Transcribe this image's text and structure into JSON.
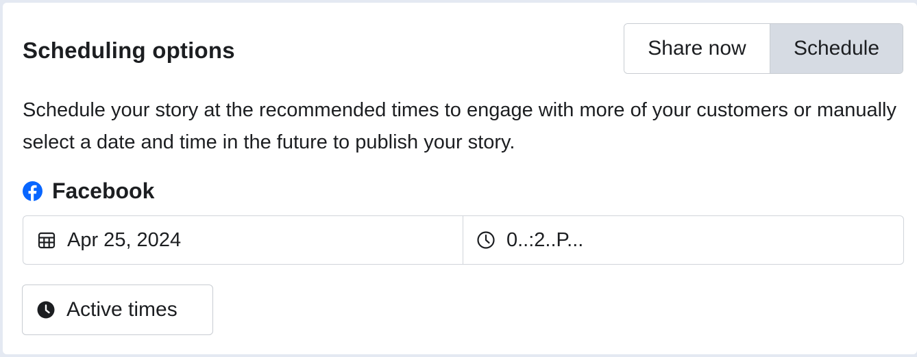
{
  "header": {
    "title": "Scheduling options"
  },
  "mode_toggle": {
    "share_now_label": "Share now",
    "schedule_label": "Schedule",
    "selected": "Schedule"
  },
  "description": "Schedule your story at the recommended times to engage with more of your customers or manually select a date and time in the future to publish your story.",
  "platform": {
    "icon": "facebook-icon",
    "name": "Facebook"
  },
  "date_picker": {
    "icon": "calendar-icon",
    "value": "Apr 25, 2024"
  },
  "time_picker": {
    "icon": "clock-icon",
    "value": "0..:2..P..."
  },
  "active_times_button": {
    "icon": "clock-filled-icon",
    "label": "Active times"
  },
  "colors": {
    "facebook_blue": "#0866ff",
    "selected_segment_bg": "#d6dbe3",
    "border": "#c8ccd2",
    "page_bg": "#e4e9f2"
  }
}
